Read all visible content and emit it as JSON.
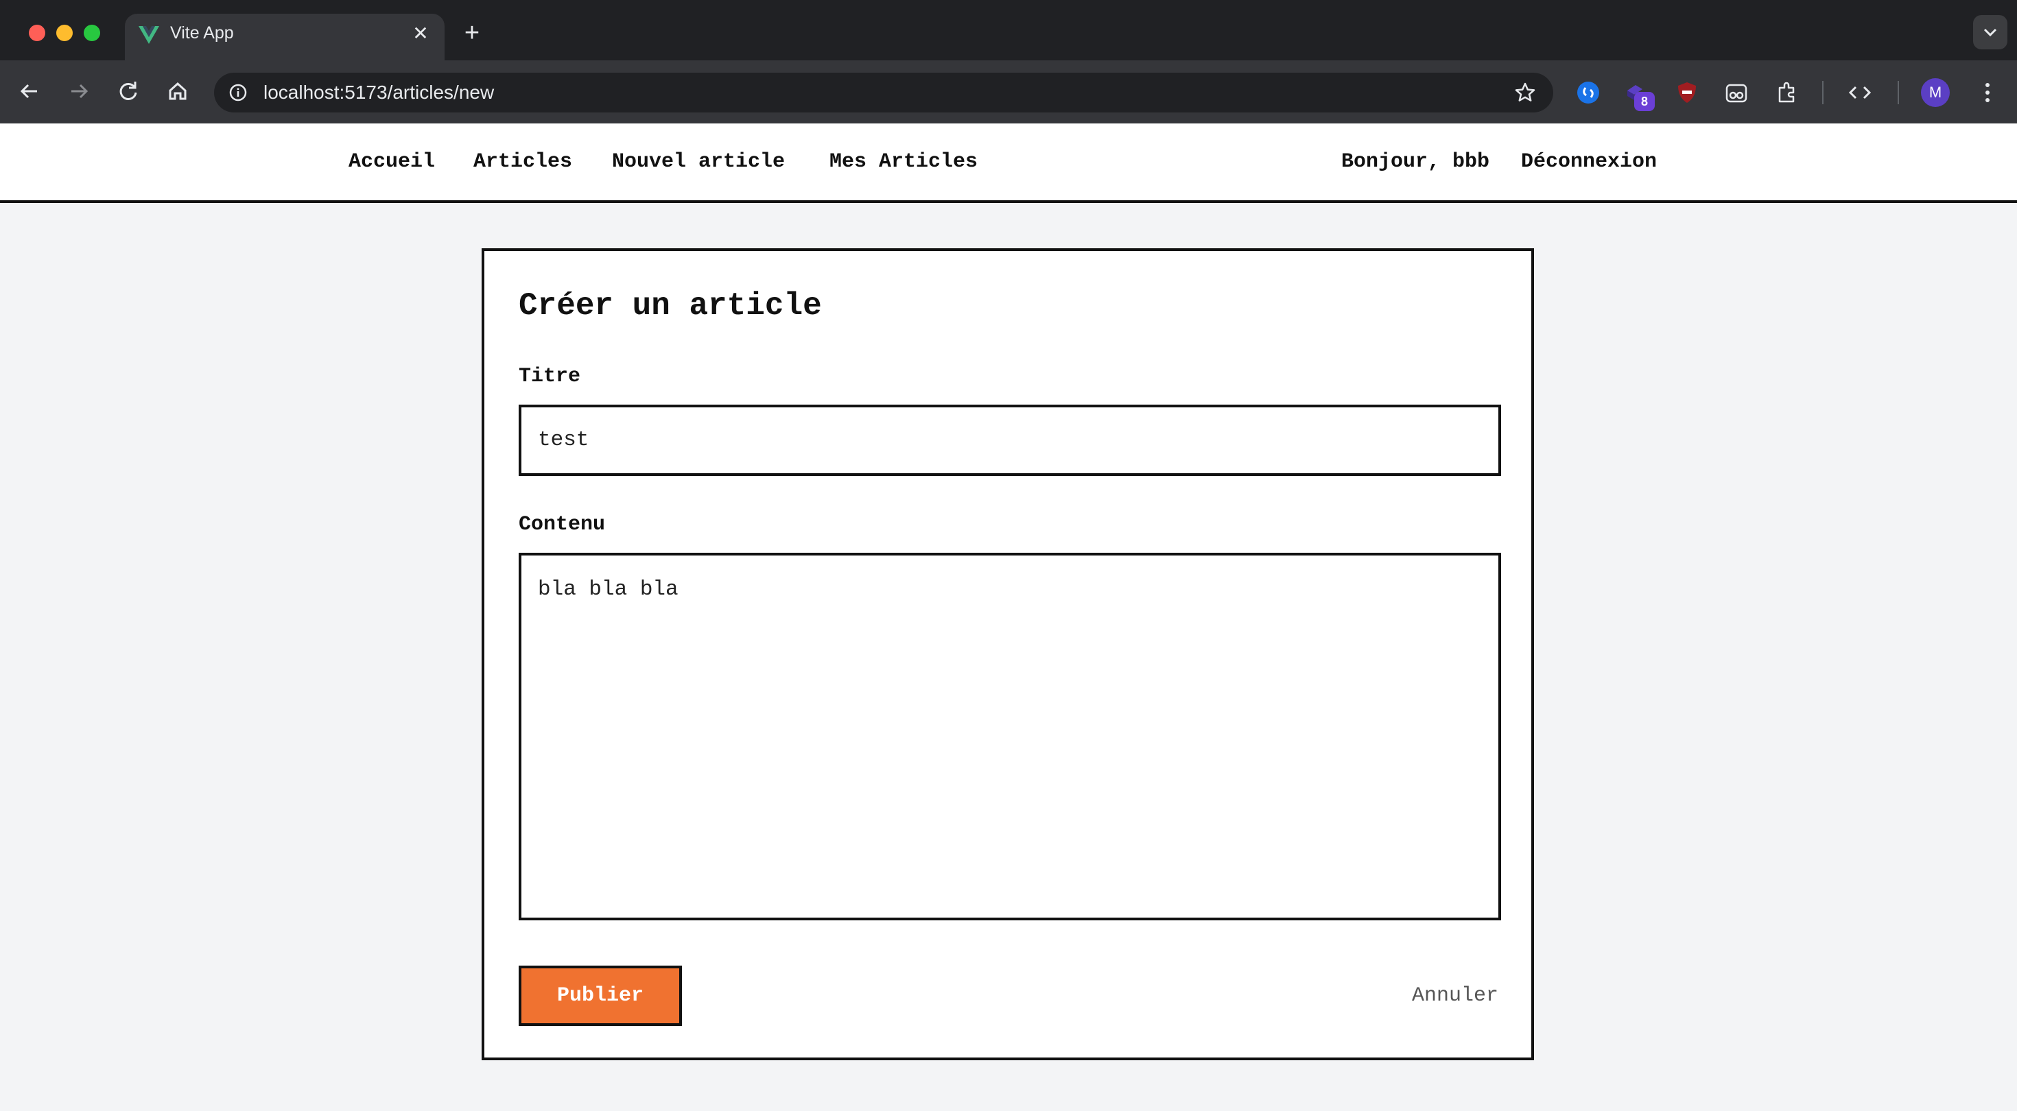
{
  "browser": {
    "tab_title": "Vite App",
    "url": "localhost:5173/articles/new",
    "extension_badge": "8",
    "profile_initial": "M"
  },
  "nav": {
    "home": "Accueil",
    "articles": "Articles",
    "new_article": "Nouvel article",
    "my_articles": "Mes Articles",
    "greeting": "Bonjour, bbb",
    "logout": "Déconnexion"
  },
  "form": {
    "heading": "Créer un article",
    "title_label": "Titre",
    "title_value": "test",
    "content_label": "Contenu",
    "content_value": "bla bla bla",
    "publish_label": "Publier",
    "cancel_label": "Annuler"
  },
  "colors": {
    "accent": "#f07230",
    "border": "#111111",
    "page_background": "#f3f4f6"
  }
}
